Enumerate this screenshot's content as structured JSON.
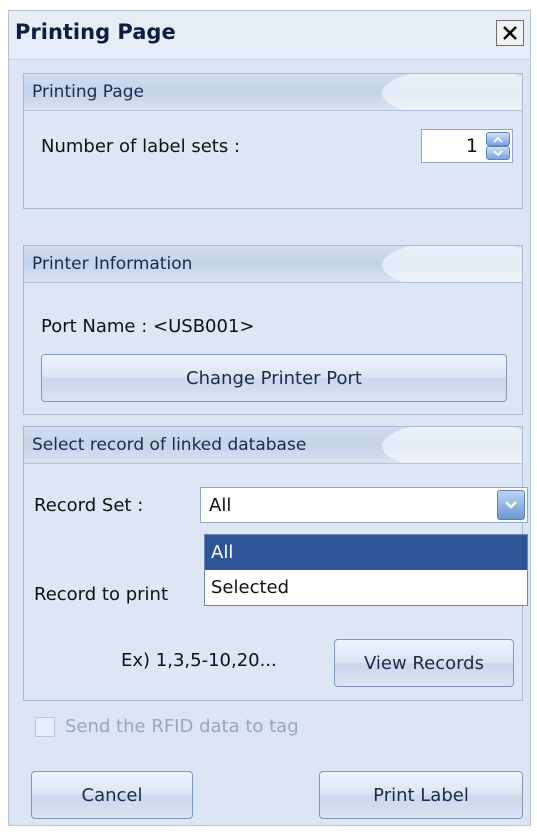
{
  "window": {
    "title": "Printing Page",
    "close_label": "X"
  },
  "printing_group": {
    "header": "Printing Page",
    "label_sets_label": "Number of label sets :",
    "label_sets_value": "1"
  },
  "printer_group": {
    "header": "Printer Information",
    "port_name": "Port Name : <USB001>",
    "change_port_button": "Change Printer Port"
  },
  "record_group": {
    "header": "Select record of linked database",
    "record_set_label": "Record Set :",
    "record_set_value": "All",
    "options": [
      {
        "label": "All",
        "selected": true
      },
      {
        "label": "Selected",
        "selected": false
      }
    ],
    "record_to_print_label": "Record to print",
    "example_text": "Ex) 1,3,5-10,20...",
    "view_records_button": "View Records"
  },
  "rfid": {
    "label": "Send the RFID data to tag",
    "checked": false,
    "enabled": false
  },
  "footer": {
    "cancel_button": "Cancel",
    "print_button": "Print Label"
  },
  "colors": {
    "accent": "#2e5396",
    "panel": "#dde6f4",
    "title": "#0d1d45"
  }
}
